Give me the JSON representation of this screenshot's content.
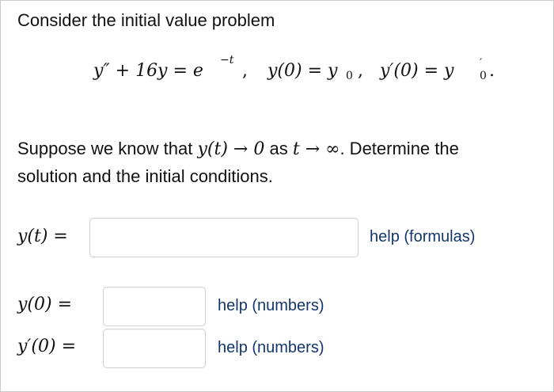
{
  "problem": {
    "intro": "Consider the initial value problem",
    "equation": {
      "lhs": "y″ + 16y = e",
      "exp": "−t",
      "ic1": "y(0) = y",
      "ic1_sub": "0",
      "ic2": "y′(0) = y",
      "ic2_prime": "′",
      "ic2_sub": "0"
    },
    "condition_before": "Suppose we know that",
    "condition_math1": "y(t) → 0",
    "condition_as": "as",
    "condition_math2": "t → ∞",
    "condition_after": ". Determine the",
    "condition_line2": "solution and the initial conditions."
  },
  "answers": {
    "yt_label": "y(t) =",
    "y0_label": "y(0) =",
    "yp0_label": "y′(0) =",
    "yt_value": "",
    "y0_value": "",
    "yp0_value": ""
  },
  "help": {
    "formulas": "help (formulas)",
    "numbers1": "help (numbers)",
    "numbers2": "help (numbers)"
  },
  "colors": {
    "help_link": "#14366b",
    "text": "#111111",
    "border": "#cfcfcf"
  }
}
